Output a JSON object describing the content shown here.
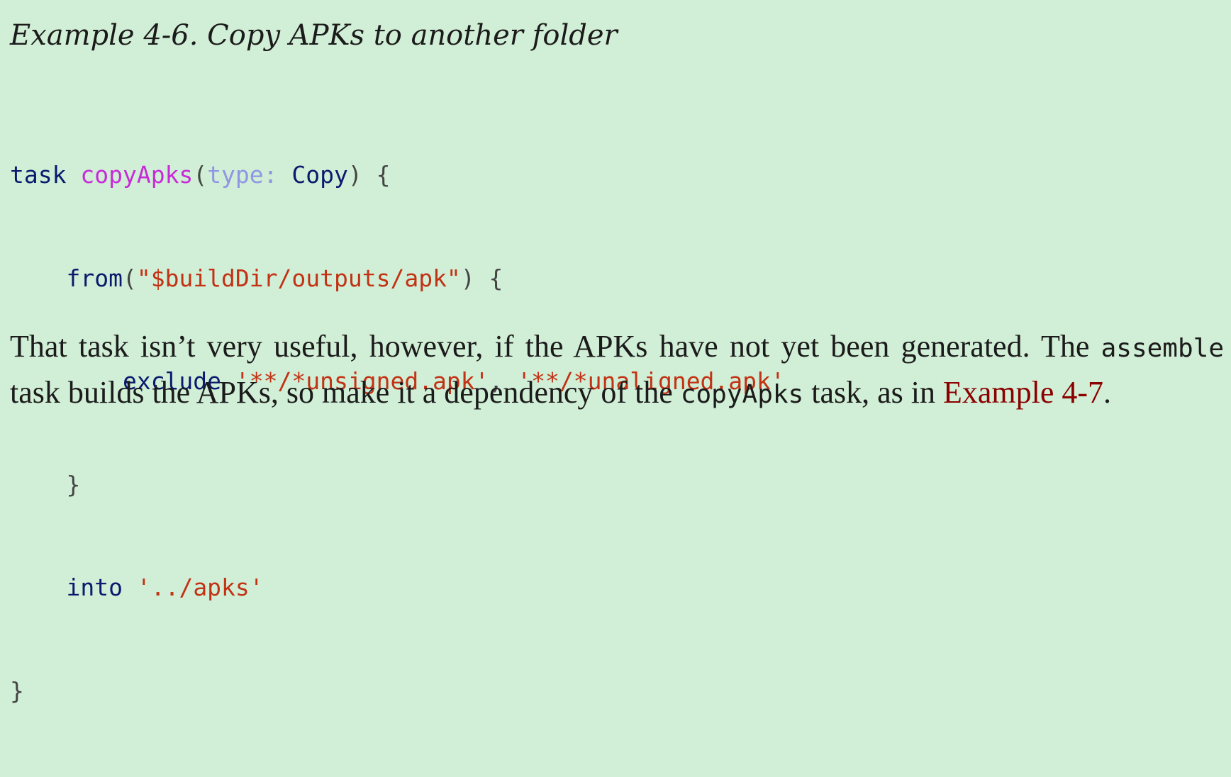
{
  "caption": "Example 4-6. Copy APKs to another folder",
  "code": {
    "l1": {
      "kw": "task",
      "fn": "copyApks",
      "open": "(",
      "param": "type:",
      "type": "Copy",
      "close": ") {"
    },
    "l2": {
      "indent": "    ",
      "kw": "from",
      "open": "(",
      "str": "\"$buildDir/outputs/apk\"",
      "close": ") {"
    },
    "l3": {
      "indent": "        ",
      "kw": "exclude",
      "str1": "'**/*unsigned.apk'",
      "sep": ", ",
      "str2": "'**/*unaligned.apk'"
    },
    "l4": {
      "indent": "    ",
      "brace": "}"
    },
    "l5": {
      "indent": "    ",
      "kw": "into",
      "str": "'../apks'"
    },
    "l6": {
      "brace": "}"
    }
  },
  "paragraph": {
    "t1": "That task isn’t very useful, however, if the APKs have not yet been generated. The ",
    "code1": "assemble",
    "t2": " task builds the APKs, so make it a dependency of the ",
    "code2": "copyApks",
    "t3": " task, as in ",
    "link": "Example 4-7",
    "t4": "."
  },
  "colors": {
    "background": "#d1eed6",
    "keyword": "#0a1a6e",
    "function": "#c72bd9",
    "parameter": "#8f96e3",
    "string": "#c23214",
    "link": "#8b0000"
  }
}
